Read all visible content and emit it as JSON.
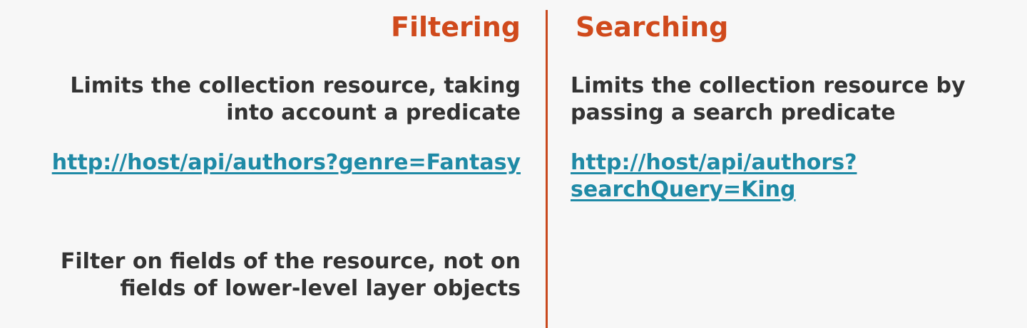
{
  "filtering": {
    "heading": "Filtering",
    "description_lines": [
      "Limits the collection resource, taking",
      "into account a predicate"
    ],
    "example_url": "http://host/api/authors?genre=Fantasy",
    "note_lines": [
      "Filter on fields of the resource, not on",
      "fields of lower-level layer objects"
    ]
  },
  "searching": {
    "heading": "Searching",
    "description_lines": [
      "Limits the collection resource by",
      "passing a search predicate"
    ],
    "example_url_lines": [
      "http://host/api/authors?",
      "searchQuery=King"
    ]
  },
  "colors": {
    "accent": "#d04a1c",
    "divider": "#c9491e",
    "link": "#1f8aa6",
    "text": "#333333",
    "background": "#f7f7f7"
  }
}
